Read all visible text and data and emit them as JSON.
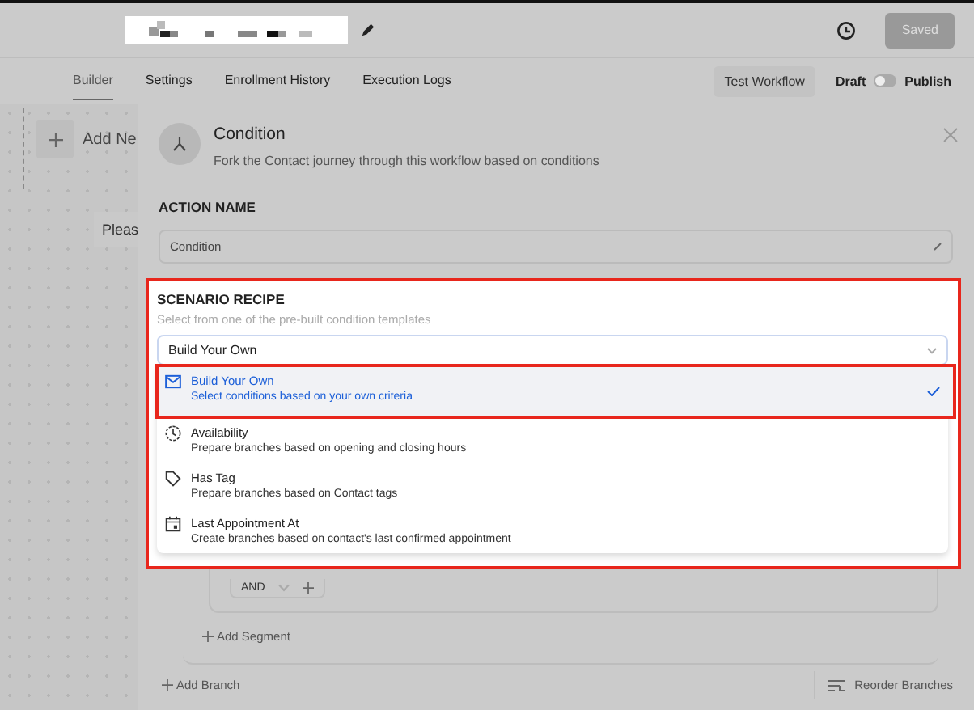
{
  "header": {
    "save_button": {
      "label": "Saved",
      "disabled": true
    }
  },
  "tabs": [
    {
      "label": "Builder",
      "selected": true
    },
    {
      "label": "Settings",
      "selected": false
    },
    {
      "label": "Enrollment History",
      "selected": false
    },
    {
      "label": "Execution Logs",
      "selected": false
    }
  ],
  "test_button": "Test Workflow",
  "publish_toggle": {
    "off_label": "Draft",
    "on_label": "Publish",
    "on": false
  },
  "canvas": {
    "add_node": "Add Ne",
    "hint": "Pleas"
  },
  "panel": {
    "title": "Condition",
    "description": "Fork the Contact journey through this workflow based on conditions",
    "action_name": {
      "label": "ACTION NAME",
      "value": "Condition"
    },
    "scenario": {
      "label": "SCENARIO RECIPE",
      "hint": "Select from one of the pre-built condition templates",
      "value": "Build Your Own",
      "options": [
        {
          "kind": "mail",
          "title": "Build Your Own",
          "description": "Select conditions based on your own criteria",
          "selected": true
        },
        {
          "kind": "clock",
          "title": "Availability",
          "description": "Prepare branches based on opening and closing hours",
          "selected": false
        },
        {
          "kind": "tag",
          "title": "Has Tag",
          "description": "Prepare branches based on Contact tags",
          "selected": false
        },
        {
          "kind": "calendar",
          "title": "Last Appointment At",
          "description": "Create branches based on contact's last confirmed appointment",
          "selected": false
        }
      ]
    },
    "operator": "AND",
    "add_segment": "Add Segment",
    "add_branch": "Add Branch",
    "reorder": "Reorder Branches"
  }
}
